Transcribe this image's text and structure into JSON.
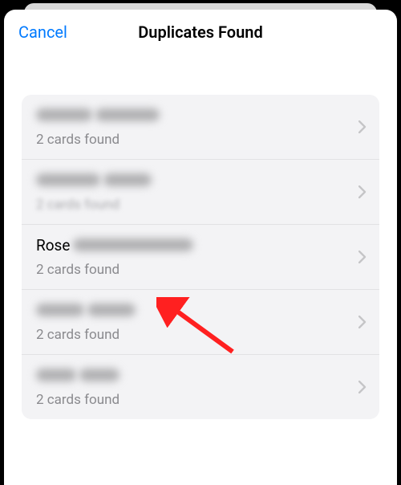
{
  "header": {
    "cancel": "Cancel",
    "title": "Duplicates Found"
  },
  "list": {
    "items": [
      {
        "clearName": "",
        "blurWidth1": 70,
        "blurWidth2": 80,
        "subtitle": "2 cards found",
        "subtitleBlurred": false
      },
      {
        "clearName": "",
        "blurWidth1": 80,
        "blurWidth2": 60,
        "subtitle": "2 cards found",
        "subtitleBlurred": true
      },
      {
        "clearName": "Rose",
        "blurWidth1": 0,
        "blurWidth2": 150,
        "subtitle": "2 cards found",
        "subtitleBlurred": false
      },
      {
        "clearName": "",
        "blurWidth1": 60,
        "blurWidth2": 60,
        "subtitle": "2 cards found",
        "subtitleBlurred": false
      },
      {
        "clearName": "",
        "blurWidth1": 50,
        "blurWidth2": 50,
        "subtitle": "2 cards found",
        "subtitleBlurred": false
      }
    ]
  },
  "colors": {
    "accent": "#007aff",
    "annotation": "#ff2020"
  }
}
